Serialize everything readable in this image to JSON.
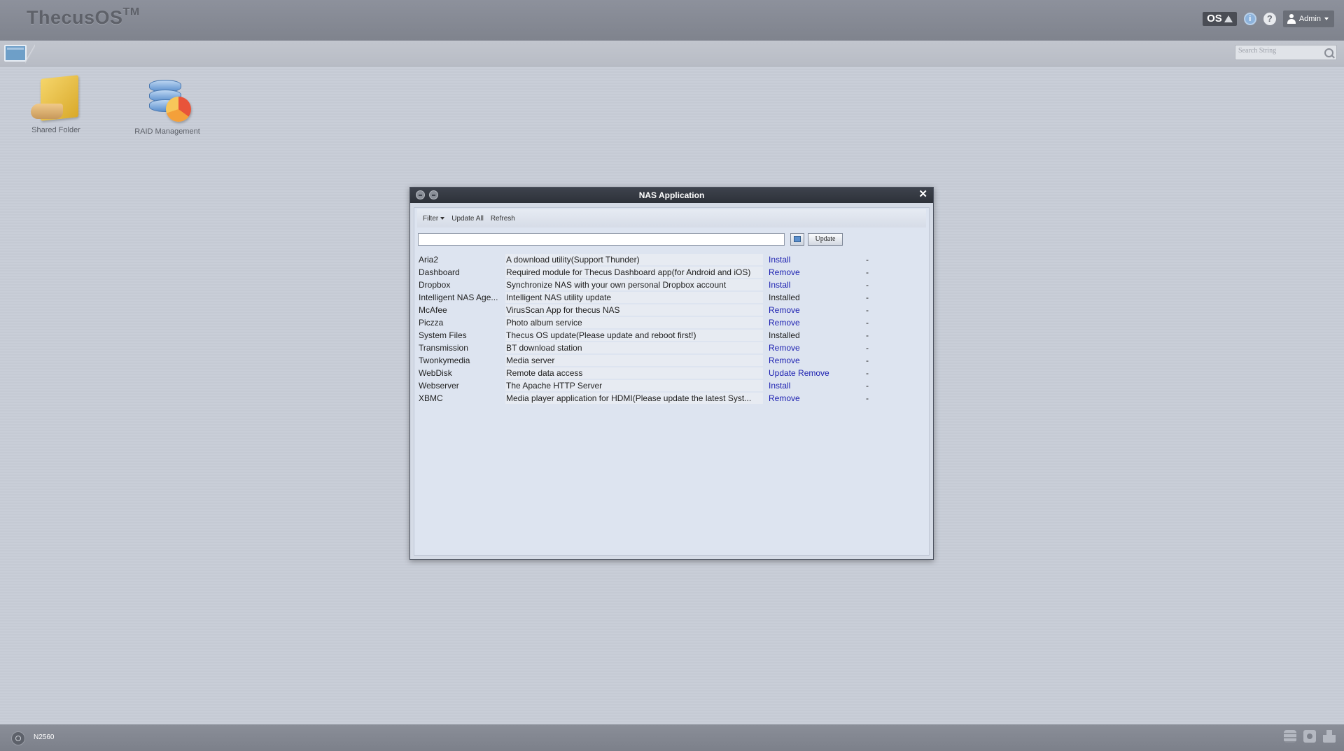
{
  "header": {
    "logo": "ThecusOS",
    "logo_tm": "TM",
    "os_badge": "OS",
    "info_icon": "i",
    "help_icon": "?",
    "user_label": "Admin"
  },
  "toolbar": {
    "search_placeholder": "Search String"
  },
  "desktop_icons": [
    {
      "label": "Shared Folder",
      "icon": "shared-folder-icon"
    },
    {
      "label": "RAID Management",
      "icon": "raid-management-icon"
    }
  ],
  "dialog": {
    "title": "NAS Application",
    "close_glyph": "✕",
    "menu": {
      "filter": "Filter",
      "update_all": "Update All",
      "refresh": "Refresh"
    },
    "update_button": "Update",
    "apps": [
      {
        "name": "Aria2",
        "description": "A download utility(Support Thunder)",
        "action": "Install",
        "extra": "-"
      },
      {
        "name": "Dashboard",
        "description": "Required module for Thecus Dashboard app(for Android and iOS)",
        "action": "Remove",
        "extra": "-"
      },
      {
        "name": "Dropbox",
        "description": "Synchronize NAS with your own personal Dropbox account",
        "action": "Install",
        "extra": "-"
      },
      {
        "name": "Intelligent NAS Age...",
        "description": "Intelligent NAS utility update",
        "action": "Installed",
        "extra": "-"
      },
      {
        "name": "McAfee",
        "description": "VirusScan App for thecus NAS",
        "action": "Remove",
        "extra": "-"
      },
      {
        "name": "Piczza",
        "description": "Photo album service",
        "action": "Remove",
        "extra": "-"
      },
      {
        "name": "System Files",
        "description": "Thecus OS update(Please update and reboot first!)",
        "action": "Installed",
        "extra": "-"
      },
      {
        "name": "Transmission",
        "description": "BT download station",
        "action": "Remove",
        "extra": "-"
      },
      {
        "name": "Twonkymedia",
        "description": "Media server",
        "action": "Remove",
        "extra": "-"
      },
      {
        "name": "WebDisk",
        "description": "Remote data access",
        "action": "Update",
        "action2": "Remove",
        "extra": "-"
      },
      {
        "name": "Webserver",
        "description": "The Apache HTTP Server",
        "action": "Install",
        "extra": "-"
      },
      {
        "name": "XBMC",
        "description": "Media player application for HDMI(Please update the latest Syst...",
        "action": "Remove",
        "extra": "-"
      }
    ]
  },
  "status_bar": {
    "model": "N2560"
  }
}
